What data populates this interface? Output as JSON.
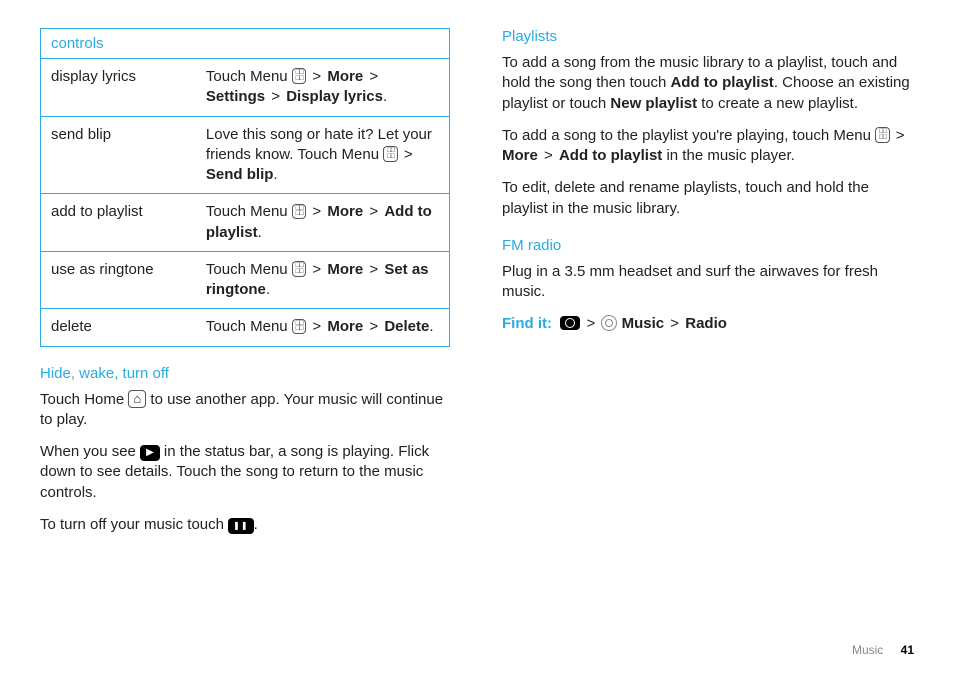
{
  "table": {
    "header": "controls",
    "rows": [
      {
        "name": "display lyrics",
        "pre": "Touch Menu ",
        "seq": [
          "More",
          "Settings",
          "Display lyrics"
        ]
      },
      {
        "name": "send blip",
        "intro": "Love this song or hate it? Let your friends know. ",
        "pre": "Touch Menu ",
        "seq": [
          "Send blip"
        ]
      },
      {
        "name": "add to playlist",
        "pre": "Touch Menu ",
        "seq": [
          "More",
          "Add to playlist"
        ]
      },
      {
        "name": "use as ringtone",
        "pre": "Touch Menu ",
        "seq": [
          "More",
          "Set as ringtone"
        ]
      },
      {
        "name": "delete",
        "pre": "Touch Menu ",
        "seq": [
          "More",
          "Delete"
        ]
      }
    ]
  },
  "hide": {
    "title": "Hide, wake, turn off",
    "p1a": "Touch Home ",
    "p1b": " to use another app. Your music will continue to play.",
    "p2a": "When you see ",
    "p2b": " in the status bar, a song is playing. Flick down to see details. Touch the song to return to the music controls.",
    "p3a": "To turn off your music touch ",
    "p3b": "."
  },
  "playlists": {
    "title": "Playlists",
    "p1a": "To add a song from the music library to a playlist, touch and hold the song then touch ",
    "p1b1": "Add to playlist",
    "p1c": ". Choose an existing playlist or touch ",
    "p1b2": "New playlist",
    "p1d": " to create a new playlist.",
    "p2a": "To add a song to the playlist you're playing, touch Menu ",
    "p2seq": [
      "More",
      "Add to playlist"
    ],
    "p2b": " in the music player.",
    "p3": "To edit, delete and rename playlists, touch and hold the playlist in the music library."
  },
  "fm": {
    "title": "FM radio",
    "p1": "Plug in a 3.5 mm headset and surf the airwaves for fresh music.",
    "find": "Find it:",
    "seq": [
      "Music",
      "Radio"
    ]
  },
  "footer": {
    "section": "Music",
    "page": "41"
  },
  "gt": ">"
}
